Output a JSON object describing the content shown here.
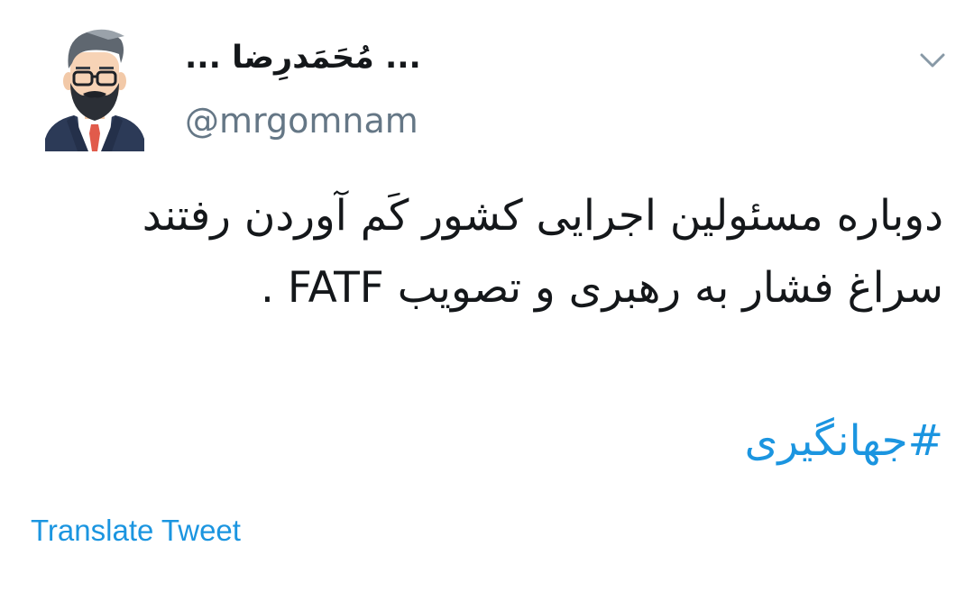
{
  "user": {
    "display_name": "... مُحَمَدرِضا ...",
    "handle": "@mrgomnam",
    "avatar_icon": "bearded-man-avatar-icon"
  },
  "menu": {
    "caret_icon": "chevron-down-icon"
  },
  "tweet": {
    "lines": [
      "دوباره مسئولین اجرایی کشور کَم آوردن رفتند",
      "سراغ فشار به رهبری و تصویب FATF ."
    ],
    "hashtag": "#جهانگیری"
  },
  "actions": {
    "translate_label": "Translate Tweet"
  },
  "colors": {
    "link": "#1b95e0",
    "handle": "#657786",
    "text": "#14171a"
  }
}
